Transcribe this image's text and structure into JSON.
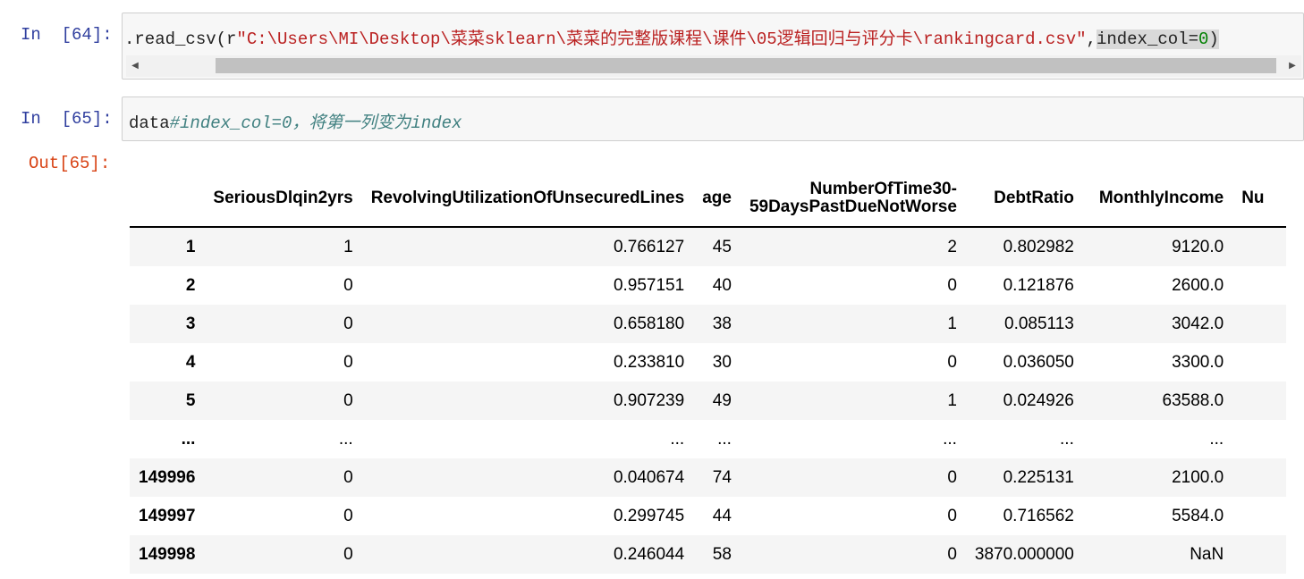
{
  "cell64": {
    "prompt": "In  [64]:",
    "code_prefix": ".read_csv(r",
    "code_string": "\"C:\\Users\\MI\\Desktop\\菜菜sklearn\\菜菜的完整版课程\\课件\\05逻辑回归与评分卡\\rankingcard.csv\"",
    "code_comma": ",",
    "code_kw": "index_col",
    "code_eq": "=",
    "code_num": "0",
    "code_close": ")"
  },
  "cell65": {
    "prompt": "In  [65]:",
    "code": "data",
    "comment": "#index_col=0，将第一列变为index",
    "out_prompt": "Out[65]:"
  },
  "dataframe": {
    "columns": [
      "SeriousDlqin2yrs",
      "RevolvingUtilizationOfUnsecuredLines",
      "age",
      "NumberOfTime30-59DaysPastDueNotWorse",
      "DebtRatio",
      "MonthlyIncome",
      "Nu"
    ],
    "column_col4_line1": "NumberOfTime30-",
    "column_col4_line2": "59DaysPastDueNotWorse",
    "rows": [
      {
        "index": "1",
        "cells": [
          "1",
          "0.766127",
          "45",
          "2",
          "0.802982",
          "9120.0",
          ""
        ]
      },
      {
        "index": "2",
        "cells": [
          "0",
          "0.957151",
          "40",
          "0",
          "0.121876",
          "2600.0",
          ""
        ]
      },
      {
        "index": "3",
        "cells": [
          "0",
          "0.658180",
          "38",
          "1",
          "0.085113",
          "3042.0",
          ""
        ]
      },
      {
        "index": "4",
        "cells": [
          "0",
          "0.233810",
          "30",
          "0",
          "0.036050",
          "3300.0",
          ""
        ]
      },
      {
        "index": "5",
        "cells": [
          "0",
          "0.907239",
          "49",
          "1",
          "0.024926",
          "63588.0",
          ""
        ]
      },
      {
        "index": "...",
        "cells": [
          "...",
          "...",
          "...",
          "...",
          "...",
          "...",
          ""
        ]
      },
      {
        "index": "149996",
        "cells": [
          "0",
          "0.040674",
          "74",
          "0",
          "0.225131",
          "2100.0",
          ""
        ]
      },
      {
        "index": "149997",
        "cells": [
          "0",
          "0.299745",
          "44",
          "0",
          "0.716562",
          "5584.0",
          ""
        ]
      },
      {
        "index": "149998",
        "cells": [
          "0",
          "0.246044",
          "58",
          "0",
          "3870.000000",
          "NaN",
          ""
        ]
      }
    ]
  }
}
